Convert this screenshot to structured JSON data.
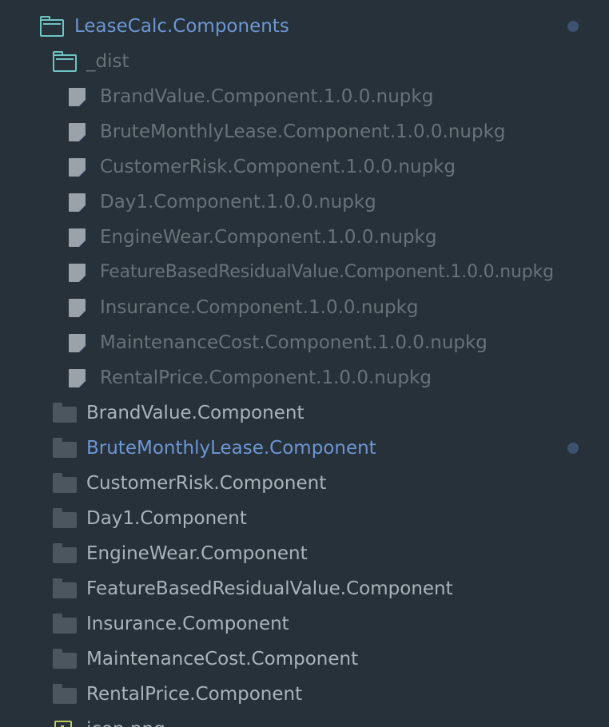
{
  "tree": {
    "partial_top_label": "",
    "root_folder": {
      "label": "LeaseCalc.Components",
      "modified": true,
      "icon": "folder-open-icon"
    },
    "dist_folder": {
      "label": "_dist",
      "icon": "folder-open-icon"
    },
    "dist_files": [
      {
        "label": "BrandValue.Component.1.0.0.nupkg",
        "icon": "package-file-icon"
      },
      {
        "label": "BruteMonthlyLease.Component.1.0.0.nupkg",
        "icon": "package-file-icon"
      },
      {
        "label": "CustomerRisk.Component.1.0.0.nupkg",
        "icon": "package-file-icon"
      },
      {
        "label": "Day1.Component.1.0.0.nupkg",
        "icon": "package-file-icon"
      },
      {
        "label": "EngineWear.Component.1.0.0.nupkg",
        "icon": "package-file-icon"
      },
      {
        "label": "FeatureBasedResidualValue.Component.1.0.0.nupkg",
        "icon": "package-file-icon"
      },
      {
        "label": "Insurance.Component.1.0.0.nupkg",
        "icon": "package-file-icon"
      },
      {
        "label": "MaintenanceCost.Component.1.0.0.nupkg",
        "icon": "package-file-icon"
      },
      {
        "label": "RentalPrice.Component.1.0.0.nupkg",
        "icon": "package-file-icon"
      }
    ],
    "component_folders": [
      {
        "label": "BrandValue.Component",
        "modified": false,
        "icon": "folder-closed-icon"
      },
      {
        "label": "BruteMonthlyLease.Component",
        "modified": true,
        "icon": "folder-closed-icon"
      },
      {
        "label": "CustomerRisk.Component",
        "modified": false,
        "icon": "folder-closed-icon"
      },
      {
        "label": "Day1.Component",
        "modified": false,
        "icon": "folder-closed-icon"
      },
      {
        "label": "EngineWear.Component",
        "modified": false,
        "icon": "folder-closed-icon"
      },
      {
        "label": "FeatureBasedResidualValue.Component",
        "modified": false,
        "icon": "folder-closed-icon"
      },
      {
        "label": "Insurance.Component",
        "modified": false,
        "icon": "folder-closed-icon"
      },
      {
        "label": "MaintenanceCost.Component",
        "modified": false,
        "icon": "folder-closed-icon"
      },
      {
        "label": "RentalPrice.Component",
        "modified": false,
        "icon": "folder-closed-icon"
      }
    ],
    "last_file": {
      "label": "icon.png",
      "icon": "image-file-icon"
    },
    "colors": {
      "background": "#263139",
      "modified_label": "#6e96d4",
      "dimmed_label": "#687279",
      "normal_label": "#a9b3ba",
      "open_folder_icon": "#6fc4c3",
      "closed_folder_icon": "#4c565e",
      "modified_dot": "#3d5270",
      "image_icon": "#c2c85f"
    }
  }
}
